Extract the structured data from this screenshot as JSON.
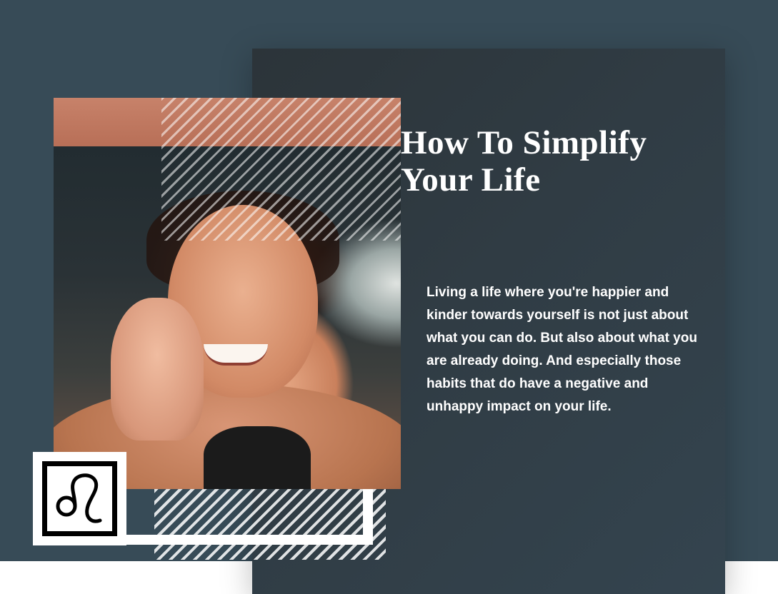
{
  "article": {
    "title": "How To Simplify Your Life",
    "body": "Living a life where you're happier and kinder towards yourself is not just about what you can do. But also about what you are already doing. And especially those habits that do have a negative and unhappy impact on your life."
  },
  "photo": {
    "icon": "smiling-woman-photo"
  },
  "logo": {
    "icon": "leo-zodiac-icon",
    "glyph": "♌"
  },
  "colors": {
    "background": "#374b57",
    "card": "#2f3a40",
    "accent_band": "#c07a62",
    "text": "#ffffff"
  }
}
